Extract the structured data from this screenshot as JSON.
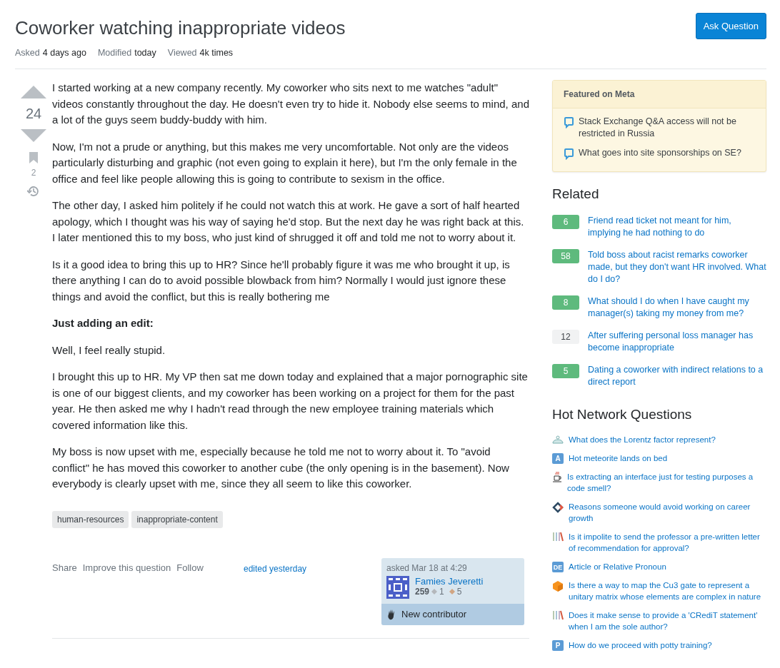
{
  "question": {
    "title": "Coworker watching inappropriate videos",
    "meta": [
      {
        "label": "Asked",
        "value": "4 days ago"
      },
      {
        "label": "Modified",
        "value": "today"
      },
      {
        "label": "Viewed",
        "value": "4k times"
      }
    ],
    "ask_button": "Ask Question",
    "votes": "24",
    "bookmarks": "2",
    "body": [
      {
        "kind": "text",
        "text": "I started working at a new company recently. My coworker who sits next to me watches \"adult\" videos constantly throughout the day. He doesn't even try to hide it. Nobody else seems to mind, and a lot of the guys seem buddy-buddy with him."
      },
      {
        "kind": "text",
        "text": "Now, I'm not a prude or anything, but this makes me very uncomfortable. Not only are the videos particularly disturbing and graphic (not even going to explain it here), but I'm the only female in the office and feel like people allowing this is going to contribute to sexism in the office."
      },
      {
        "kind": "text",
        "text": "The other day, I asked him politely if he could not watch this at work. He gave a sort of half hearted apology, which I thought was his way of saying he'd stop. But the next day he was right back at this. I later mentioned this to my boss, who just kind of shrugged it off and told me not to worry about it."
      },
      {
        "kind": "text",
        "text": "Is it a good idea to bring this up to HR? Since he'll probably figure it was me who brought it up, is there anything I can do to avoid possible blowback from him? Normally I would just ignore these things and avoid the conflict, but this is really bothering me"
      },
      {
        "kind": "heading",
        "text": "Just adding an edit:"
      },
      {
        "kind": "text",
        "text": "Well, I feel really stupid."
      },
      {
        "kind": "text",
        "text": "I brought this up to HR. My VP then sat me down today and explained that a major pornographic site is one of our biggest clients, and my coworker has been working on a project for them for the past year. He then asked me why I hadn't read through the new employee training materials which covered information like this."
      },
      {
        "kind": "text",
        "text": "My boss is now upset with me, especially because he told me not to worry about it. To \"avoid conflict\" he has moved this coworker to another cube (the only opening is in the basement). Now everybody is clearly upset with me, since they all seem to like this coworker."
      }
    ],
    "tags": [
      "human-resources",
      "inappropriate-content"
    ],
    "actions": [
      "Share",
      "Improve this question",
      "Follow"
    ],
    "edited": "edited yesterday",
    "author": {
      "asked": "asked Mar 18 at 4:29",
      "name": "Famies Jeveretti",
      "reputation": "259",
      "silver": "1",
      "bronze": "5",
      "badge": "New contributor"
    }
  },
  "sidebar": {
    "featured": {
      "title": "Featured on Meta",
      "items": [
        "Stack Exchange Q&A access will not be restricted in Russia",
        "What goes into site sponsorships on SE?"
      ]
    },
    "related": {
      "title": "Related",
      "items": [
        {
          "score": "6",
          "accepted": true,
          "text": "Friend read ticket not meant for him, implying he had nothing to do"
        },
        {
          "score": "58",
          "accepted": true,
          "text": "Told boss about racist remarks coworker made, but they don't want HR involved. What do I do?"
        },
        {
          "score": "8",
          "accepted": true,
          "text": "What should I do when I have caught my manager(s) taking my money from me?"
        },
        {
          "score": "12",
          "accepted": false,
          "text": "After suffering personal loss manager has become inappropriate"
        },
        {
          "score": "5",
          "accepted": true,
          "text": "Dating a coworker with indirect relations to a direct report"
        }
      ]
    },
    "hot": {
      "title": "Hot Network Questions",
      "items": [
        {
          "kind": "physics",
          "text": "What does the Lorentz factor represent?"
        },
        {
          "kind": "letter",
          "mark": "A",
          "text": "Hot meteorite lands on bed"
        },
        {
          "kind": "cup",
          "text": "Is extracting an interface just for testing purposes a code smell?"
        },
        {
          "kind": "diamond",
          "text": "Reasons someone would avoid working on career growth"
        },
        {
          "kind": "books",
          "text": "Is it impolite to send the professor a pre-written letter of recommendation for approval?"
        },
        {
          "kind": "letter",
          "mark": "DE",
          "text": "Article or Relative Pronoun"
        },
        {
          "kind": "cube",
          "text": "Is there a way to map the Cu3 gate to represent a unitary matrix whose elements are complex in nature"
        },
        {
          "kind": "books",
          "text": "Does it make sense to provide a 'CRediT statement' when I am the sole author?"
        },
        {
          "kind": "letter",
          "mark": "P",
          "text": "How do we proceed with potty training?"
        }
      ]
    }
  }
}
